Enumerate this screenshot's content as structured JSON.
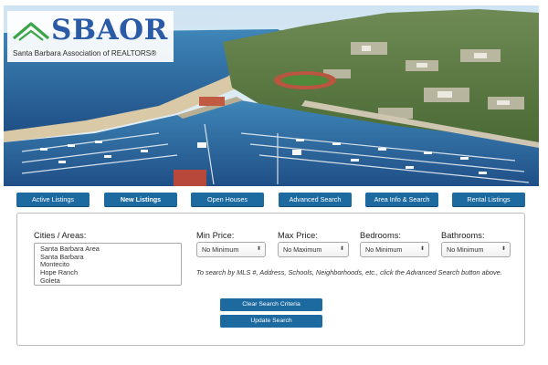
{
  "brand": {
    "logo_text": "SBAOR",
    "tagline": "Santa Barbara Association of REALTORS®",
    "primary_color": "#1d6aa1",
    "logo_color": "#2b5aa6",
    "accent_green": "#3aa548"
  },
  "hero": {
    "icon": "harbor-photo"
  },
  "nav": {
    "items": [
      {
        "label": "Active Listings"
      },
      {
        "label": "New Listings"
      },
      {
        "label": "Open Houses"
      },
      {
        "label": "Advanced Search"
      },
      {
        "label": "Area Info & Search"
      },
      {
        "label": "Rental Listings"
      }
    ]
  },
  "search": {
    "cities_label": "Cities / Areas:",
    "cities": [
      "Santa Barbara Area",
      "Santa Barbara",
      "Montecito",
      "Hope Ranch",
      "Goleta"
    ],
    "min_price_label": "Min Price:",
    "min_price_value": "No Minimum",
    "max_price_label": "Max Price:",
    "max_price_value": "No Maximum",
    "bedrooms_label": "Bedrooms:",
    "bedrooms_value": "No Minimum",
    "bathrooms_label": "Bathrooms:",
    "bathrooms_value": "No Minimum",
    "hint": "To search by MLS #, Address, Schools, Neighborhoods, etc., click the Advanced Search button above.",
    "clear_label": "Clear Search Criteria",
    "update_label": "Update Search"
  }
}
